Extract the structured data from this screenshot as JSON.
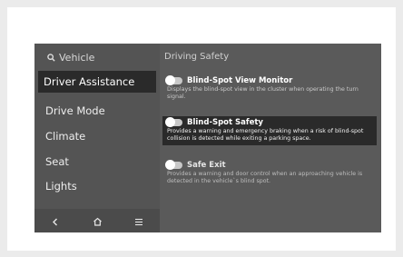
{
  "sidebar": {
    "search_label": "Vehicle",
    "items": [
      {
        "label": "Driver Assistance",
        "selected": true
      },
      {
        "label": "Drive Mode",
        "selected": false
      },
      {
        "label": "Climate",
        "selected": false
      },
      {
        "label": "Seat",
        "selected": false
      },
      {
        "label": "Lights",
        "selected": false
      }
    ],
    "bottom_icons": [
      "back-icon",
      "home-icon",
      "menu-icon"
    ]
  },
  "content": {
    "section_title": "Driving Safety",
    "settings": [
      {
        "name": "Blind-Spot View Monitor",
        "description": "Displays the blind-spot view in the cluster when operating the turn signal.",
        "enabled": false
      },
      {
        "name": "Blind-Spot Safety",
        "description": "Provides a warning and emergency braking when a risk of blind-spot collision is detected while exiting a parking space.",
        "enabled": false
      },
      {
        "name": "Safe Exit",
        "description": "Provides a warning and door control when an approaching vehicle is detected in the vehicle`s blind spot.",
        "enabled": false
      }
    ]
  },
  "colors": {
    "background": "#5a5a5a",
    "highlight": "#2a2a2a",
    "text": "#ffffff"
  }
}
